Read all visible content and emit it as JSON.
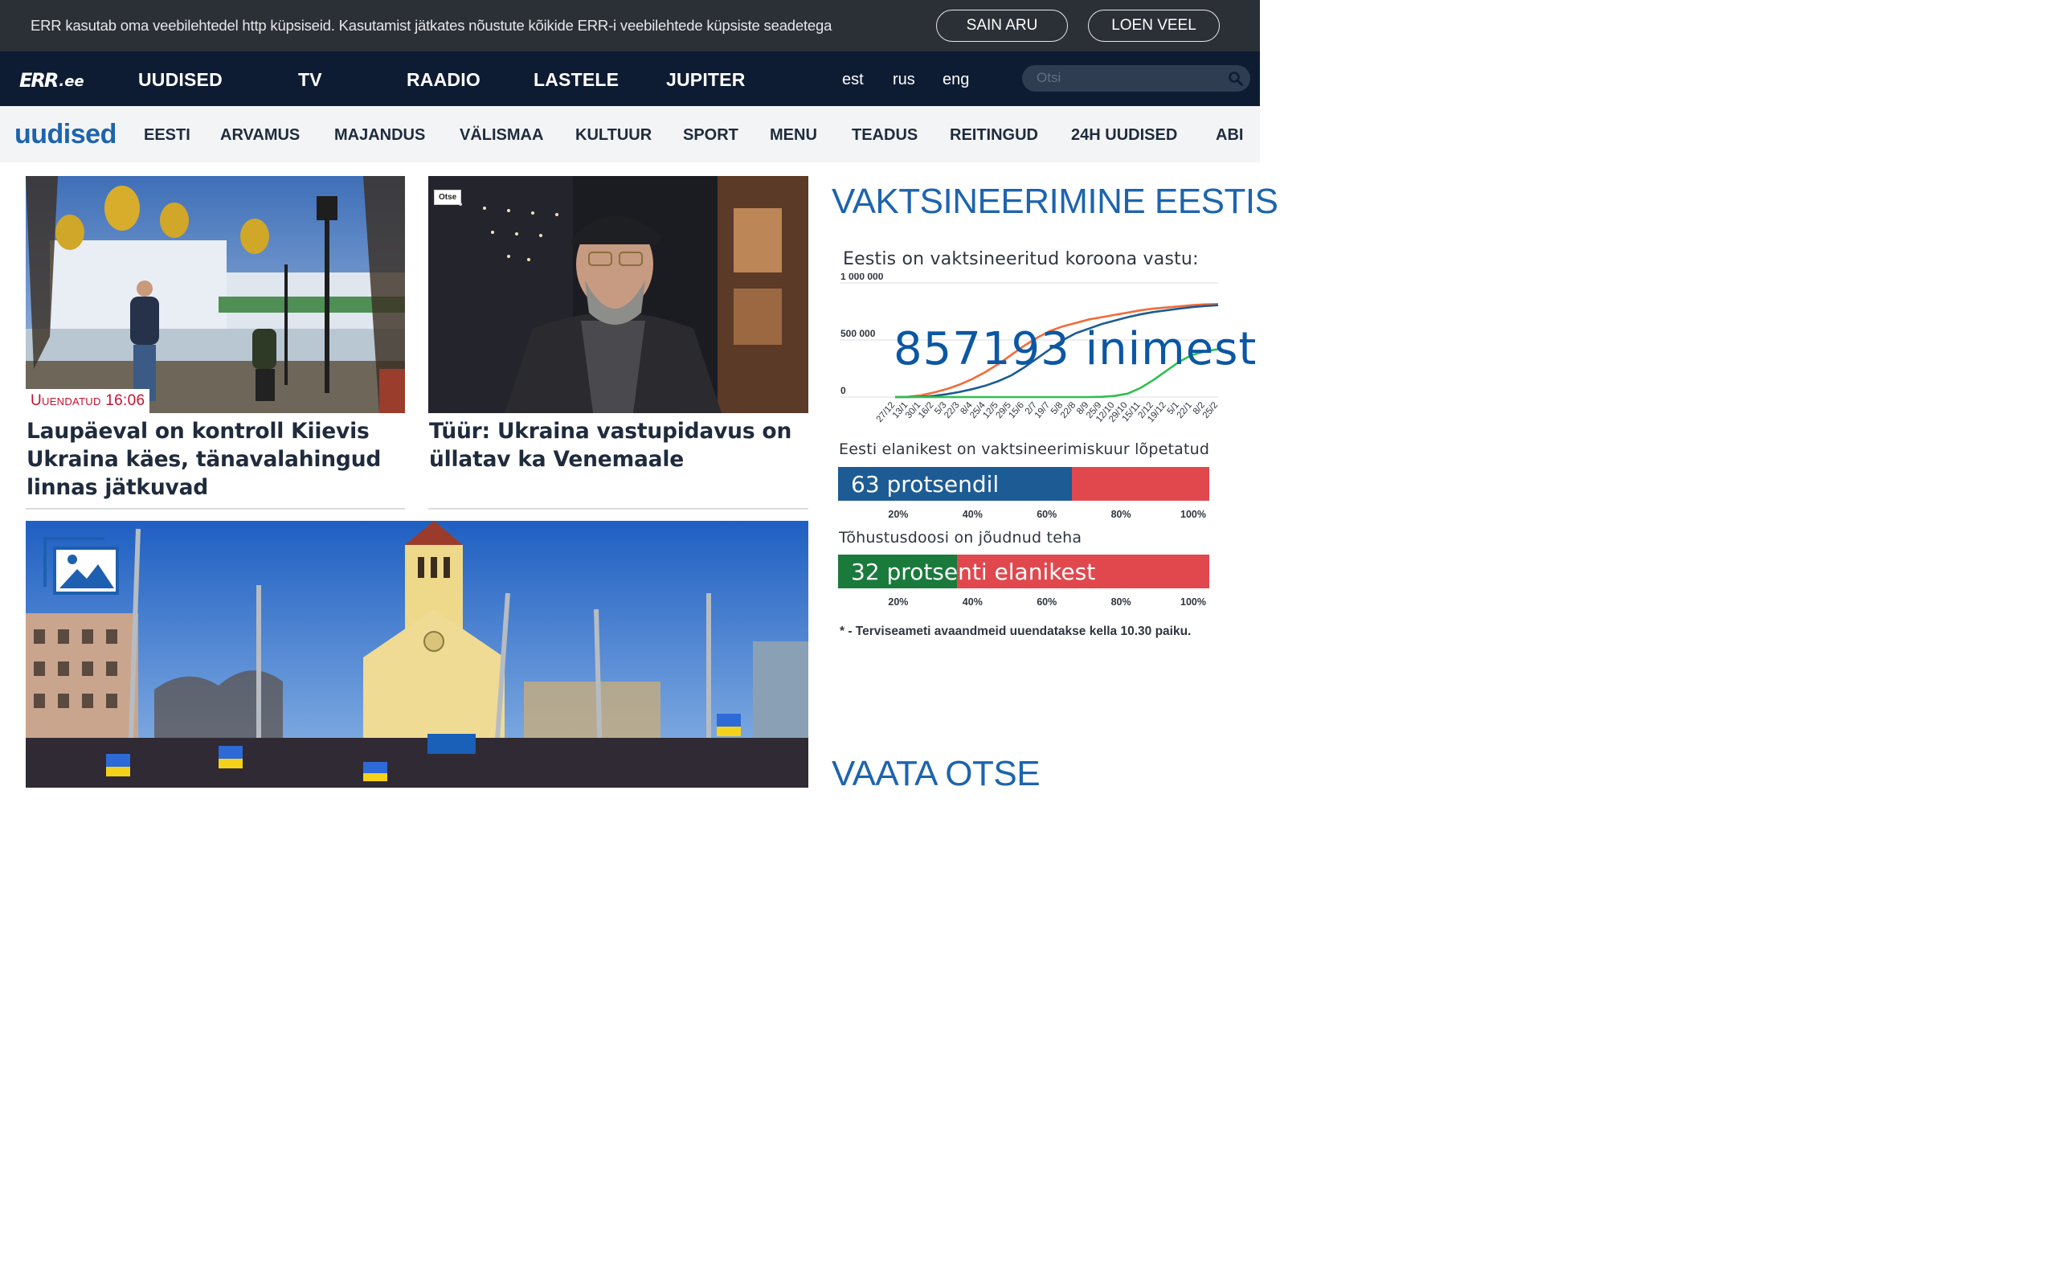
{
  "cookie_bar": {
    "text": "ERR kasutab oma veebilehtedel http küpsiseid. Kasutamist jätkates nõustute kõikide ERR-i veebilehtede küpsiste seadetega",
    "accept_label": "SAIN ARU",
    "more_label": "LOEN VEEL"
  },
  "header": {
    "logo_mark": "ERR",
    "logo_tld": ".ee",
    "nav": [
      "UUDISED",
      "TV",
      "RAADIO",
      "LASTELE",
      "JUPITER"
    ],
    "languages": [
      "est",
      "rus",
      "eng"
    ],
    "search_placeholder": "Otsi"
  },
  "subnav": {
    "section_logo": "uudised",
    "items": [
      "EESTI",
      "ARVAMUS",
      "MAJANDUS",
      "VÄLISMAA",
      "KULTUUR",
      "SPORT",
      "MENU",
      "TEADUS",
      "REITINGUD",
      "24H UUDISED",
      "ABI"
    ]
  },
  "articles": [
    {
      "badge": "Uuendatud 16:06",
      "title": "Laupäeval on kontroll Kiievis Ukraina käes, tänavalahingud linnas jätkuvad"
    },
    {
      "badge": "Otse",
      "title": "Tüür: Ukraina vastupidavus on üllatav ka Venemaale"
    }
  ],
  "sidebar": {
    "heading": "VAKTSINEERIMINE EESTIS",
    "chart_caption": "Eestis on vaktsineeritud koroona vastu:",
    "count_text": "857193 inimest",
    "bar1_caption": "Eesti elanikest on vaktsineerimiskuur lõpetatud",
    "bar1_text": "63 protsendil",
    "bar2_caption": "Tõhustusdoosi on jõudnud teha",
    "bar2_text": "32 protsenti elanikest",
    "axis_ticks": [
      "20%",
      "40%",
      "60%",
      "80%",
      "100%"
    ],
    "footnote": "* - Terviseameti avaandmeid uuendatakse kella 10.30 paiku.",
    "heading2": "VAATA OTSE",
    "colors": {
      "first_dose": "#f26b3a",
      "completed": "#1d5b94",
      "booster": "#2fbf4f",
      "remaining": "#e0484e",
      "bar1_fill": "#1d5b94",
      "bar2_fill": "#1a7a3c"
    }
  },
  "chart_data": [
    {
      "type": "line",
      "title": "Eestis on vaktsineeritud koroona vastu:",
      "ylim": [
        0,
        1000000
      ],
      "y_ticks": [
        "1 000 000",
        "500 000",
        "0"
      ],
      "categories": [
        "27/12",
        "13/1",
        "30/1",
        "16/2",
        "5/3",
        "22/3",
        "8/4",
        "25/4",
        "12/5",
        "29/5",
        "15/6",
        "2/7",
        "19/7",
        "5/8",
        "22/8",
        "8/9",
        "25/9",
        "12/10",
        "29/10",
        "15/11",
        "2/12",
        "19/12",
        "5/1",
        "22/1",
        "8/2",
        "25/2"
      ],
      "series": [
        {
          "values": [
            0,
            2000,
            15000,
            40000,
            70000,
            110000,
            160000,
            220000,
            290000,
            370000,
            450000,
            520000,
            580000,
            620000,
            650000,
            680000,
            700000,
            720000,
            740000,
            760000,
            775000,
            785000,
            795000,
            805000,
            812000,
            815000
          ]
        },
        {
          "values": [
            0,
            0,
            2000,
            10000,
            25000,
            45000,
            70000,
            100000,
            140000,
            190000,
            260000,
            340000,
            420000,
            500000,
            560000,
            600000,
            640000,
            670000,
            700000,
            725000,
            745000,
            760000,
            775000,
            788000,
            798000,
            805000
          ]
        },
        {
          "values": [
            0,
            0,
            0,
            0,
            0,
            0,
            0,
            0,
            0,
            0,
            0,
            0,
            0,
            0,
            0,
            0,
            2000,
            10000,
            30000,
            80000,
            150000,
            230000,
            310000,
            370000,
            400000,
            420000
          ]
        }
      ]
    },
    {
      "type": "bar",
      "categories": [
        "Eesti elanikest on vaktsineerimiskuur lõpetatud",
        "Tõhustusdoosi on jõudnud teha"
      ],
      "values": [
        63,
        32
      ],
      "xlim": [
        0,
        100
      ]
    }
  ]
}
